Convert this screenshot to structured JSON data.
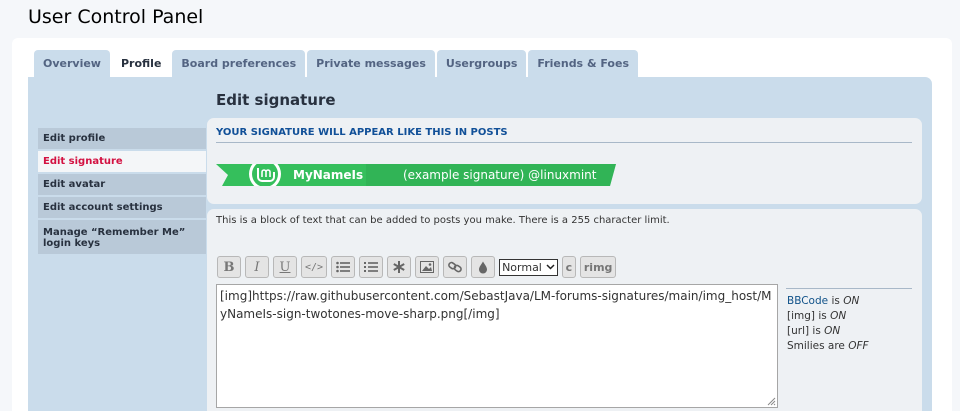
{
  "page_title": "User Control Panel",
  "tabs": [
    {
      "label": "Overview",
      "active": false
    },
    {
      "label": "Profile",
      "active": true
    },
    {
      "label": "Board preferences",
      "active": false
    },
    {
      "label": "Private messages",
      "active": false
    },
    {
      "label": "Usergroups",
      "active": false
    },
    {
      "label": "Friends & Foes",
      "active": false
    }
  ],
  "sidebar": {
    "items": [
      {
        "label": "Edit profile",
        "active": false
      },
      {
        "label": "Edit signature",
        "active": true
      },
      {
        "label": "Edit avatar",
        "active": false
      },
      {
        "label": "Edit account settings",
        "active": false
      },
      {
        "label": "Manage “Remember Me” login keys",
        "active": false
      }
    ]
  },
  "section_title": "Edit signature",
  "preview": {
    "heading": "YOUR SIGNATURE WILL APPEAR LIKE THIS IN POSTS",
    "name": "MyNameIs",
    "tagline": "(example signature) @linuxmint",
    "logo_letter": "lm"
  },
  "intro_text": "This is a block of text that can be added to posts you make. There is a 255 character limit.",
  "toolbar": {
    "bold": "B",
    "italic": "I",
    "underline": "U",
    "code_icon": "</>",
    "font_size_value": "Normal",
    "color_label": "c",
    "rimg_label": "rimg"
  },
  "editor_value": "[img]https://raw.githubusercontent.com/SebastJava/LM-forums-signatures/main/img_host/MyNameIs-sign-twotones-move-sharp.png[/img]",
  "status": {
    "bbcode_label": "BBCode",
    "bbcode_is": "is",
    "bbcode_state": "ON",
    "img_label": "[img] is",
    "img_state": "ON",
    "url_label": "[url] is",
    "url_state": "ON",
    "smilies_label": "Smilies are",
    "smilies_state": "OFF"
  },
  "colors": {
    "tab_bg": "#cadceb",
    "nav_active_text": "#d31141",
    "mint_green": "#35bf5c",
    "link_blue": "#105289"
  }
}
